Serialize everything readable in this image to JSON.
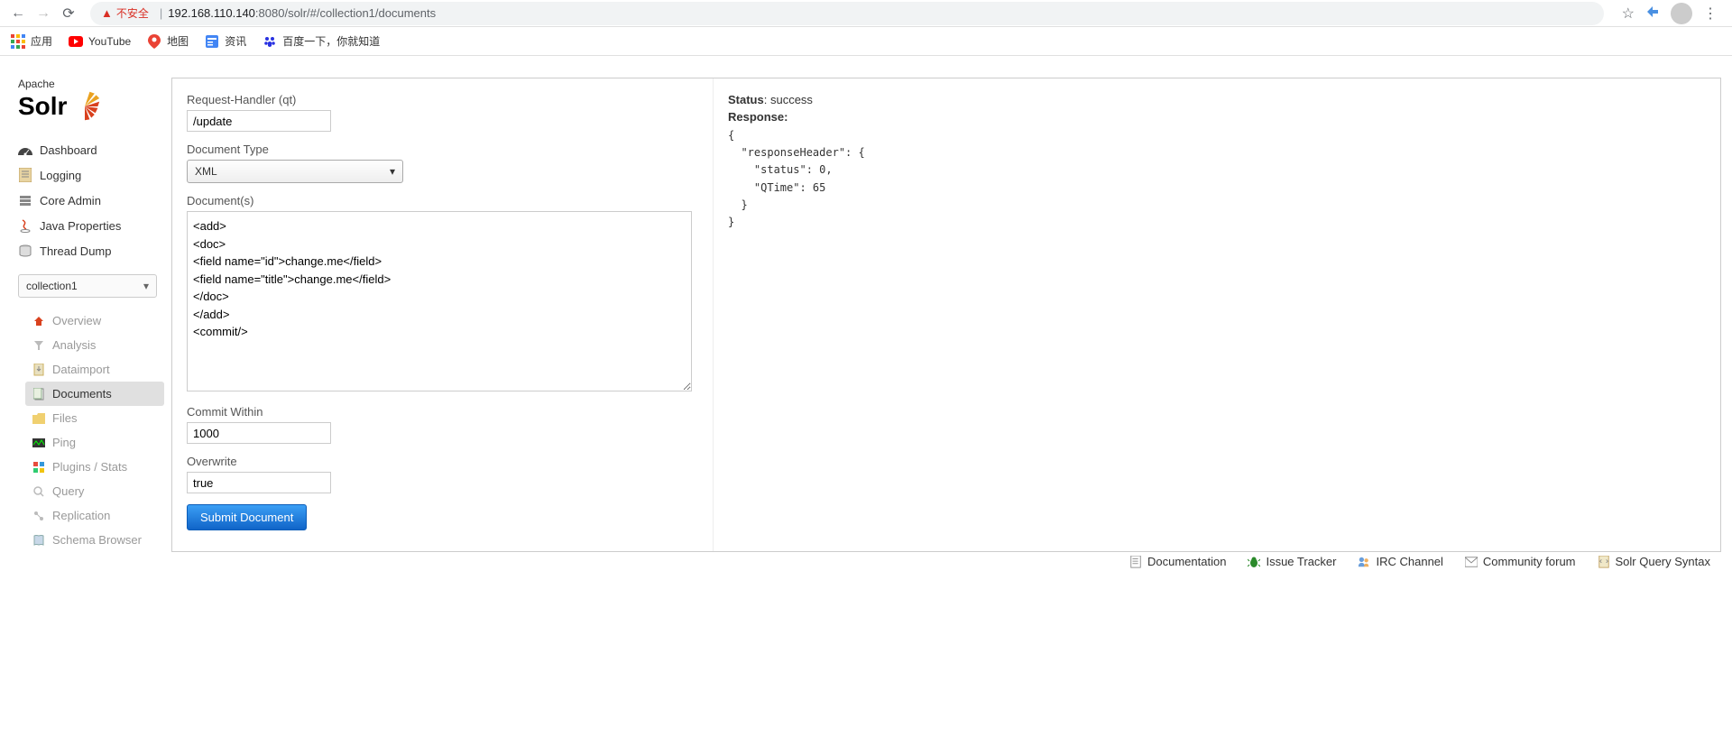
{
  "browser": {
    "insecure_label": "不安全",
    "url_domain": "192.168.110.140",
    "url_port": ":8080",
    "url_path": "/solr/#/collection1/documents"
  },
  "bookmarks": {
    "apps": "应用",
    "youtube": "YouTube",
    "maps": "地图",
    "news": "资讯",
    "baidu": "百度一下，你就知道"
  },
  "logo": {
    "brand_top": "Apache",
    "brand_main": "Solr"
  },
  "nav": {
    "dashboard": "Dashboard",
    "logging": "Logging",
    "core_admin": "Core Admin",
    "java_props": "Java Properties",
    "thread_dump": "Thread Dump"
  },
  "core_selector": {
    "selected": "collection1"
  },
  "sub_nav": {
    "overview": "Overview",
    "analysis": "Analysis",
    "dataimport": "Dataimport",
    "documents": "Documents",
    "files": "Files",
    "ping": "Ping",
    "plugins": "Plugins / Stats",
    "query": "Query",
    "replication": "Replication",
    "schema": "Schema Browser"
  },
  "form": {
    "request_handler_label": "Request-Handler (qt)",
    "request_handler_value": "/update",
    "doc_type_label": "Document Type",
    "doc_type_value": "XML",
    "documents_label": "Document(s)",
    "documents_value": "<add>\n<doc>\n<field name=\"id\">change.me</field>\n<field name=\"title\">change.me</field>\n</doc>\n</add>\n<commit/>",
    "commit_within_label": "Commit Within",
    "commit_within_value": "1000",
    "overwrite_label": "Overwrite",
    "overwrite_value": "true",
    "submit_label": "Submit Document"
  },
  "response": {
    "status_label": "Status",
    "status_value": "success",
    "response_label": "Response:",
    "body": "{\n  \"responseHeader\": {\n    \"status\": 0,\n    \"QTime\": 65\n  }\n}"
  },
  "footer": {
    "documentation": "Documentation",
    "issue_tracker": "Issue Tracker",
    "irc": "IRC Channel",
    "forum": "Community forum",
    "query_syntax": "Solr Query Syntax"
  }
}
